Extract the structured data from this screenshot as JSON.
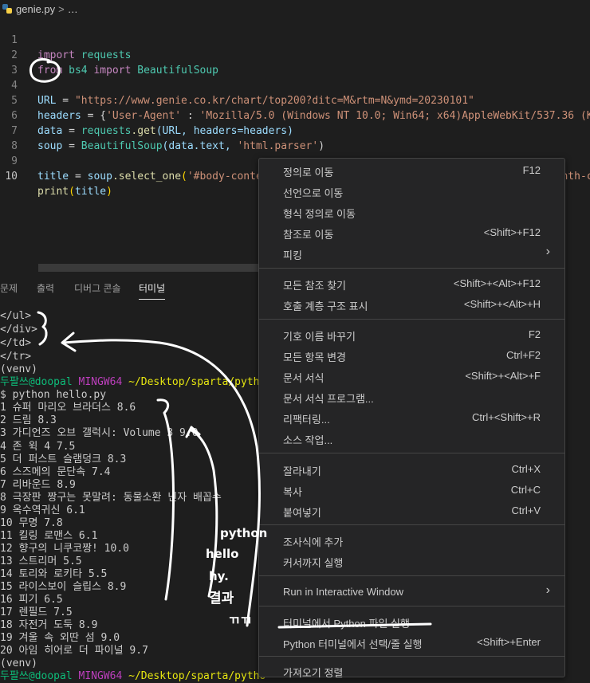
{
  "breadcrumb": {
    "file": "genie.py",
    "more": "…",
    "sep": ">"
  },
  "editor": {
    "line_numbers": [
      "1",
      "2",
      "3",
      "4",
      "5",
      "6",
      "7",
      "8",
      "9",
      "10"
    ],
    "line1": {
      "kw": "import",
      "mod": "requests"
    },
    "line2": {
      "kw1": "from",
      "mod1": "bs4",
      "kw2": "import",
      "mod2": "BeautifulSoup"
    },
    "line4": {
      "var": "URL",
      "eq": " = ",
      "str": "\"https://www.genie.co.kr/chart/top200?ditc=M&rtm=N&ymd=20230101\""
    },
    "line5": {
      "var": "headers",
      "eq": " = {",
      "key": "'User-Agent'",
      "colon": " : ",
      "val": "'Mozilla/5.0 (Windows NT 10.0; Win64; x64)AppleWebKit/537.36 (KH"
    },
    "line6": {
      "var": "data",
      "eq": " = ",
      "mod": "requests",
      "fn": ".get",
      "args": "(URL, headers=headers)"
    },
    "line7": {
      "var": "soup",
      "eq": " = ",
      "fn": "BeautifulSoup",
      "a1": "(data.text, ",
      "a2": "'html.parser'",
      "a3": ")"
    },
    "line9": {
      "var": "title",
      "eq": " = ",
      "obj": "soup",
      "fn": ".select_one",
      "open": "(",
      "str": "'#body-content > div.newest-list > div > table > tbody > tr:nth-ch"
    },
    "line10": {
      "fn": "print",
      "open": "(",
      "arg": "title",
      "close": ")"
    }
  },
  "panel": {
    "tabs": [
      "문제",
      "출력",
      "디버그 콘솔",
      "터미널"
    ],
    "active_tab": "터미널"
  },
  "terminal": {
    "pre_lines": [
      "</ul>",
      "</div>",
      "</td>",
      "</tr>",
      "(venv)"
    ],
    "prompt_user": "두팔쓰@doopal",
    "prompt_host": "MINGW64",
    "prompt_path": "~/Desktop/sparta/pytho",
    "command": "$ python hello.py",
    "results": [
      "1 슈퍼 마리오 브라더스 8.6",
      "2 드림 8.3",
      "3 가디언즈 오브 갤럭시: Volume 3 9.0",
      "4 존 윅 4 7.5",
      "5 더 퍼스트 슬램덩크 8.3",
      "6 스즈메의 문단속 7.4",
      "7 리바운드 8.9",
      "8 극장판 짱구는 못말려: 동물소환 닌자 배꼽수",
      "9 옥수역귀신 6.1",
      "10 무명 7.8",
      "11 킬링 로맨스 6.1",
      "12 향구의 니쿠코짱! 10.0",
      "13 스트리머 5.5",
      "14 토리와 로키타 5.5",
      "15 라이스보이 슬립스 8.9",
      "16 피기 6.5",
      "17 렌필드 7.5",
      "18 자전거 도둑 8.9",
      "19 겨울 속 외딴 섬 9.0",
      "20 아임 히어로 더 파이널 9.7"
    ],
    "post_line": "(venv)",
    "post_prompt_user": "두팔쓰@doopal",
    "post_prompt_host": "MINGW64",
    "post_prompt_path": "~/Desktop/sparta/pytho"
  },
  "context_menu": {
    "items": [
      {
        "label": "정의로 이동",
        "shortcut": "F12"
      },
      {
        "label": "선언으로 이동",
        "shortcut": ""
      },
      {
        "label": "형식 정의로 이동",
        "shortcut": ""
      },
      {
        "label": "참조로 이동",
        "shortcut": "<Shift>+F12"
      },
      {
        "label": "피킹",
        "shortcut": ""
      },
      {
        "label": "모든 참조 찾기",
        "shortcut": "<Shift>+<Alt>+F12"
      },
      {
        "label": "호출 계층 구조 표시",
        "shortcut": "<Shift>+<Alt>+H"
      },
      {
        "label": "기호 이름 바꾸기",
        "shortcut": "F2"
      },
      {
        "label": "모든 항목 변경",
        "shortcut": "Ctrl+F2"
      },
      {
        "label": "문서 서식",
        "shortcut": "<Shift>+<Alt>+F"
      },
      {
        "label": "문서 서식 프로그램...",
        "shortcut": ""
      },
      {
        "label": "리팩터링...",
        "shortcut": "Ctrl+<Shift>+R"
      },
      {
        "label": "소스 작업...",
        "shortcut": ""
      },
      {
        "label": "잘라내기",
        "shortcut": "Ctrl+X"
      },
      {
        "label": "복사",
        "shortcut": "Ctrl+C"
      },
      {
        "label": "붙여넣기",
        "shortcut": "Ctrl+V"
      },
      {
        "label": "조사식에 추가",
        "shortcut": ""
      },
      {
        "label": "커서까지 실행",
        "shortcut": ""
      },
      {
        "label": "Run in Interactive Window",
        "shortcut": ""
      },
      {
        "label": "터미널에서 Python 파일 실행",
        "shortcut": ""
      },
      {
        "label": "Python 터미널에서 선택/줄 실행",
        "shortcut": "<Shift>+Enter"
      },
      {
        "label": "가져오기 정렬",
        "shortcut": ""
      }
    ],
    "submenu_arrow": "›"
  },
  "annotation": {
    "lines": [
      "python",
      "hello",
      "hy.",
      "결과",
      "ㄲㄲ"
    ],
    "ink_color": "#ffffff"
  },
  "colors": {
    "background": "#1e1e1e",
    "menu_bg": "#252526",
    "accent_keyword": "#c586c0",
    "string": "#ce9178",
    "prompt_user": "#0dbc79",
    "prompt_host": "#bc3fbc",
    "prompt_path": "#e5e510"
  }
}
